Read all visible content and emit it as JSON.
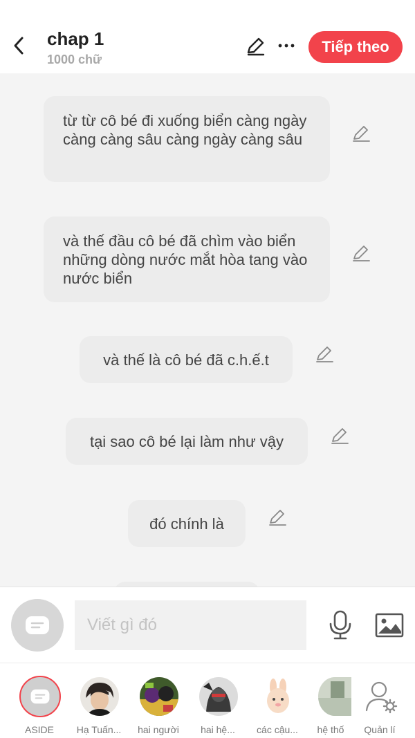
{
  "header": {
    "title": "chap 1",
    "subtitle": "1000 chữ",
    "next_label": "Tiếp theo",
    "icons": [
      "back-icon",
      "pencil-icon",
      "more-icon"
    ],
    "accent_color": "#f2434b"
  },
  "messages": [
    {
      "text": "từ từ cô bé đi xuống biển càng ngày càng càng sâu càng ngày càng sâu"
    },
    {
      "text": "và thế đầu cô bé đã chìm vào biển những dòng nước mắt hòa tang vào nước biển"
    },
    {
      "text": "và thế là cô bé đã c.h.ế.t"
    },
    {
      "text": "tại sao cô bé lại làm như vậy"
    },
    {
      "text": "đó chính là"
    }
  ],
  "composer": {
    "placeholder": "Viết gì đó",
    "icons": [
      "aside-icon",
      "microphone-icon",
      "image-icon"
    ]
  },
  "characters": [
    {
      "label": "ASIDE"
    },
    {
      "label": "Hạ Tuấn..."
    },
    {
      "label": "hai người"
    },
    {
      "label": "hai hệ..."
    },
    {
      "label": "các cậu..."
    },
    {
      "label": "hệ thố"
    },
    {
      "label": "Quản lí"
    }
  ]
}
